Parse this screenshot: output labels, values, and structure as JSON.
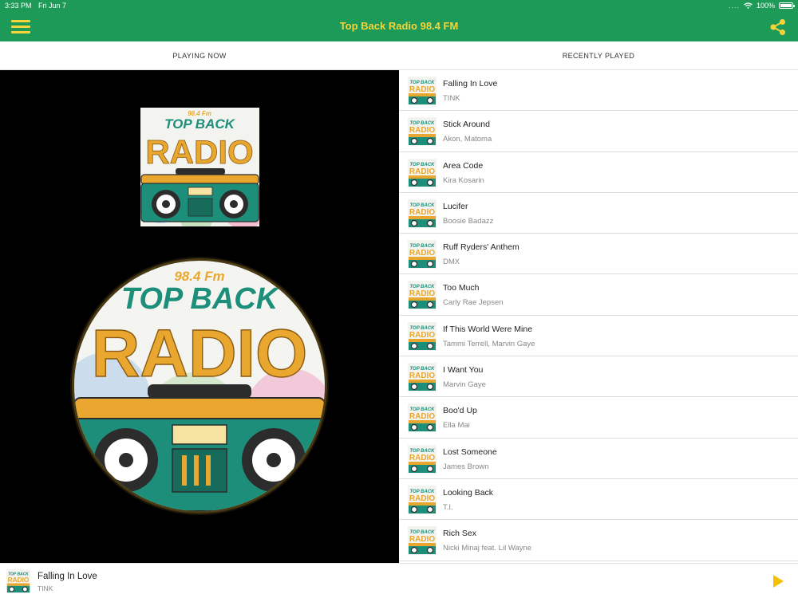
{
  "status_bar": {
    "time": "3:33 PM",
    "date": "Fri Jun 7",
    "signal_dots": "....",
    "battery": "100%"
  },
  "header": {
    "title": "Top Back Radio 98.4 FM",
    "menu_icon": "hamburger-menu-icon",
    "share_icon": "share-icon"
  },
  "tabs": [
    {
      "label": "PLAYING NOW"
    },
    {
      "label": "RECENTLY PLAYED"
    }
  ],
  "artwork": {
    "logo_text_top": "98.4 Fm",
    "logo_text_mid": "TOP BACK",
    "logo_text_main": "RADIO"
  },
  "recently_played": [
    {
      "song": "Falling In Love",
      "artist": "TINK"
    },
    {
      "song": "Stick Around",
      "artist": "Akon, Matoma"
    },
    {
      "song": "Area Code",
      "artist": "Kira Kosarin"
    },
    {
      "song": "Lucifer",
      "artist": "Boosie Badazz"
    },
    {
      "song": "Ruff Ryders' Anthem",
      "artist": "DMX"
    },
    {
      "song": "Too Much",
      "artist": "Carly Rae Jepsen"
    },
    {
      "song": "If This World Were Mine",
      "artist": "Tammi Terrell, Marvin Gaye"
    },
    {
      "song": "I Want You",
      "artist": "Marvin Gaye"
    },
    {
      "song": "Boo'd Up",
      "artist": "Ella Mai"
    },
    {
      "song": "Lost Someone",
      "artist": "James Brown"
    },
    {
      "song": "Looking Back",
      "artist": "T.I."
    },
    {
      "song": "Rich Sex",
      "artist": "Nicki Minaj feat. Lil Wayne"
    }
  ],
  "player": {
    "song": "Falling In Love",
    "artist": "TINK",
    "play_icon": "play-icon"
  },
  "colors": {
    "header_green": "#1e9a58",
    "accent_yellow": "#f7d43a",
    "logo_orange": "#e9a72f",
    "logo_teal": "#1d8e7a"
  }
}
